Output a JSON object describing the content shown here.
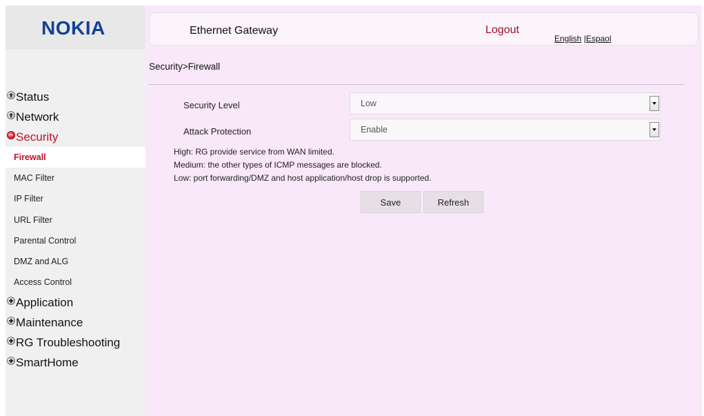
{
  "brand": {
    "logo": "NOKIA",
    "title": "Ethernet Gateway"
  },
  "header": {
    "logout": "Logout",
    "lang_english": "English",
    "lang_sep": " |",
    "lang_espanol": "Espaol"
  },
  "breadcrumb": "Security>Firewall",
  "sidebar": {
    "status": "Status",
    "network": "Network",
    "security": "Security",
    "security_items": [
      "Firewall",
      "MAC Filter",
      "IP Filter",
      "URL Filter",
      "Parental Control",
      "DMZ and ALG",
      "Access Control"
    ],
    "application": "Application",
    "maintenance": "Maintenance",
    "rg_troubleshooting": "RG Troubleshooting",
    "smarthome": "SmartHome"
  },
  "form": {
    "security_level_label": "Security Level",
    "security_level_value": "Low",
    "attack_protection_label": "Attack Protection",
    "attack_protection_value": "Enable"
  },
  "descriptions": {
    "high": "High: RG provide service from WAN limited.",
    "medium": "Medium: the other types of ICMP messages are blocked.",
    "low": "Low: port forwarding/DMZ and host application/host drop is supported."
  },
  "buttons": {
    "save": "Save",
    "refresh": "Refresh"
  },
  "colors": {
    "brand_blue": "#124191",
    "accent_red": "#c0102a",
    "content_bg": "#f9e8f9"
  }
}
